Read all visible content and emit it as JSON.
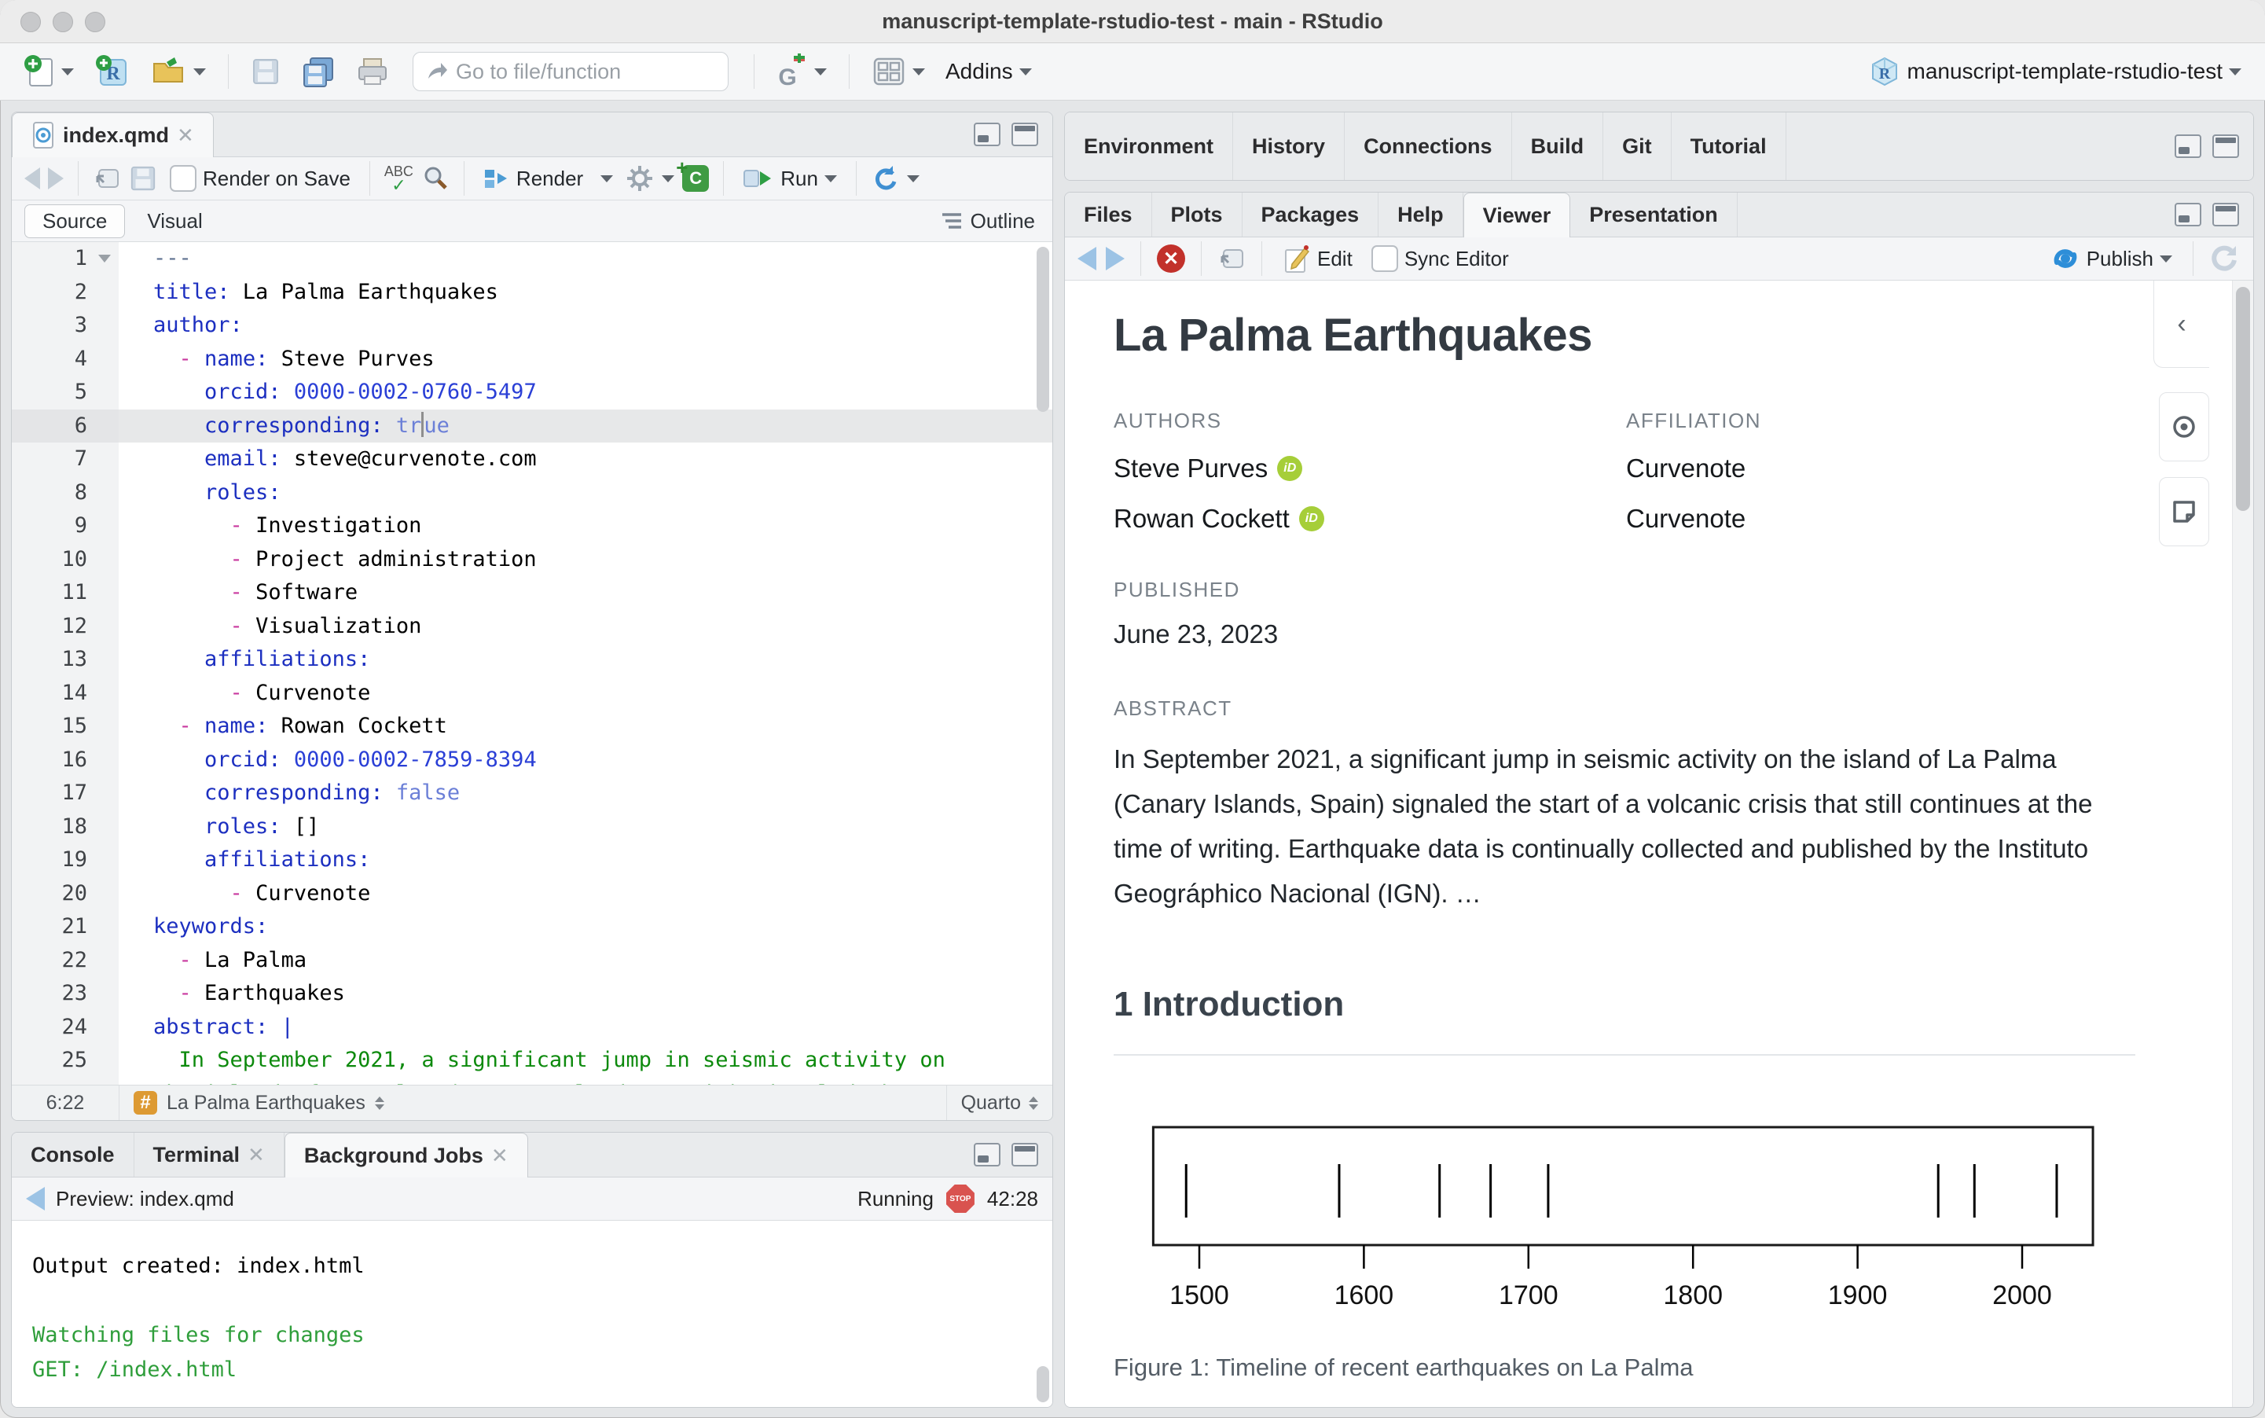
{
  "window": {
    "title": "manuscript-template-rstudio-test - main - RStudio"
  },
  "toolbar": {
    "goto_placeholder": "Go to file/function",
    "addins_label": "Addins",
    "project_label": "manuscript-template-rstudio-test"
  },
  "editor": {
    "tab": "index.qmd",
    "render_on_save": "Render on Save",
    "render_label": "Render",
    "run_label": "Run",
    "source_label": "Source",
    "visual_label": "Visual",
    "outline_label": "Outline",
    "status": {
      "position": "6:22",
      "section": "La Palma Earthquakes",
      "mode": "Quarto"
    },
    "lines": [
      {
        "n": "1",
        "fold": true,
        "segs": [
          [
            "m",
            "---"
          ]
        ]
      },
      {
        "n": "2",
        "segs": [
          [
            "k",
            "title:"
          ],
          [
            "p",
            " La Palma Earthquakes"
          ]
        ]
      },
      {
        "n": "3",
        "segs": [
          [
            "k",
            "author:"
          ]
        ]
      },
      {
        "n": "4",
        "segs": [
          [
            "p",
            "  "
          ],
          [
            "d",
            "-"
          ],
          [
            "p",
            " "
          ],
          [
            "k",
            "name:"
          ],
          [
            "p",
            " Steve Purves"
          ]
        ]
      },
      {
        "n": "5",
        "segs": [
          [
            "p",
            "    "
          ],
          [
            "k",
            "orcid:"
          ],
          [
            "p",
            " "
          ],
          [
            "n",
            "0000-0002-0760-5497"
          ]
        ]
      },
      {
        "n": "6",
        "current": true,
        "segs": [
          [
            "p",
            "    "
          ],
          [
            "k",
            "corresponding:"
          ],
          [
            "p",
            " "
          ],
          [
            "b",
            "tr"
          ],
          [
            "caret",
            ""
          ],
          [
            "b",
            "ue"
          ]
        ]
      },
      {
        "n": "7",
        "segs": [
          [
            "p",
            "    "
          ],
          [
            "k",
            "email:"
          ],
          [
            "p",
            " steve@curvenote.com"
          ]
        ]
      },
      {
        "n": "8",
        "segs": [
          [
            "p",
            "    "
          ],
          [
            "k",
            "roles:"
          ]
        ]
      },
      {
        "n": "9",
        "segs": [
          [
            "p",
            "      "
          ],
          [
            "d",
            "-"
          ],
          [
            "p",
            " Investigation"
          ]
        ]
      },
      {
        "n": "10",
        "segs": [
          [
            "p",
            "      "
          ],
          [
            "d",
            "-"
          ],
          [
            "p",
            " Project administration"
          ]
        ]
      },
      {
        "n": "11",
        "segs": [
          [
            "p",
            "      "
          ],
          [
            "d",
            "-"
          ],
          [
            "p",
            " Software"
          ]
        ]
      },
      {
        "n": "12",
        "segs": [
          [
            "p",
            "      "
          ],
          [
            "d",
            "-"
          ],
          [
            "p",
            " Visualization"
          ]
        ]
      },
      {
        "n": "13",
        "segs": [
          [
            "p",
            "    "
          ],
          [
            "k",
            "affiliations:"
          ]
        ]
      },
      {
        "n": "14",
        "segs": [
          [
            "p",
            "      "
          ],
          [
            "d",
            "-"
          ],
          [
            "p",
            " Curvenote"
          ]
        ]
      },
      {
        "n": "15",
        "segs": [
          [
            "p",
            "  "
          ],
          [
            "d",
            "-"
          ],
          [
            "p",
            " "
          ],
          [
            "k",
            "name:"
          ],
          [
            "p",
            " Rowan Cockett"
          ]
        ]
      },
      {
        "n": "16",
        "segs": [
          [
            "p",
            "    "
          ],
          [
            "k",
            "orcid:"
          ],
          [
            "p",
            " "
          ],
          [
            "n",
            "0000-0002-7859-8394"
          ]
        ]
      },
      {
        "n": "17",
        "segs": [
          [
            "p",
            "    "
          ],
          [
            "k",
            "corresponding:"
          ],
          [
            "p",
            " "
          ],
          [
            "b",
            "false"
          ]
        ]
      },
      {
        "n": "18",
        "segs": [
          [
            "p",
            "    "
          ],
          [
            "k",
            "roles:"
          ],
          [
            "p",
            " []"
          ]
        ]
      },
      {
        "n": "19",
        "segs": [
          [
            "p",
            "    "
          ],
          [
            "k",
            "affiliations:"
          ]
        ]
      },
      {
        "n": "20",
        "segs": [
          [
            "p",
            "      "
          ],
          [
            "d",
            "-"
          ],
          [
            "p",
            " Curvenote"
          ]
        ]
      },
      {
        "n": "21",
        "segs": [
          [
            "k",
            "keywords:"
          ]
        ]
      },
      {
        "n": "22",
        "segs": [
          [
            "p",
            "  "
          ],
          [
            "d",
            "-"
          ],
          [
            "p",
            " La Palma"
          ]
        ]
      },
      {
        "n": "23",
        "segs": [
          [
            "p",
            "  "
          ],
          [
            "d",
            "-"
          ],
          [
            "p",
            " Earthquakes"
          ]
        ]
      },
      {
        "n": "24",
        "segs": [
          [
            "k",
            "abstract:"
          ],
          [
            "p",
            " "
          ],
          [
            "k",
            "|"
          ]
        ]
      },
      {
        "n": "25",
        "segs": [
          [
            "s",
            "  In September 2021, a significant jump in seismic activity on"
          ]
        ]
      },
      {
        "n": "",
        "segs": [
          [
            "s",
            "the island of La Palma (Canary Islands, Spain) signaled the start"
          ]
        ]
      }
    ]
  },
  "console": {
    "tabs": [
      "Console",
      "Terminal",
      "Background Jobs"
    ],
    "active_tab": "Background Jobs",
    "toolbar": {
      "label": "Preview: index.qmd",
      "status": "Running",
      "stop": "STOP",
      "time": "42:28"
    },
    "output": [
      {
        "text": "Output created: index.html",
        "color": "black"
      },
      {
        "text": "",
        "color": "black"
      },
      {
        "text": "Watching files for changes",
        "color": "green"
      },
      {
        "text": "GET: /index.html",
        "color": "green"
      }
    ]
  },
  "right_top": {
    "tabs": [
      "Environment",
      "History",
      "Connections",
      "Build",
      "Git",
      "Tutorial"
    ]
  },
  "viewer": {
    "tabs": [
      "Files",
      "Plots",
      "Packages",
      "Help",
      "Viewer",
      "Presentation"
    ],
    "active_tab": "Viewer",
    "toolbar": {
      "edit": "Edit",
      "sync": "Sync Editor",
      "publish": "Publish"
    },
    "doc": {
      "title": "La Palma Earthquakes",
      "authors_label": "AUTHORS",
      "affiliation_label": "AFFILIATION",
      "authors": [
        {
          "name": "Steve Purves",
          "affiliation": "Curvenote"
        },
        {
          "name": "Rowan Cockett",
          "affiliation": "Curvenote"
        }
      ],
      "published_label": "PUBLISHED",
      "published": "June 23, 2023",
      "abstract_label": "ABSTRACT",
      "abstract": "In September 2021, a significant jump in seismic activity on the island of La Palma (Canary Islands, Spain) signaled the start of a volcanic crisis that still continues at the time of writing. Earthquake data is continually collected and published by the Instituto Geográphico Nacional (IGN). …",
      "section_heading": "1 Introduction",
      "figure_caption": "Figure 1: Timeline of recent earthquakes on La Palma"
    }
  },
  "chart_data": {
    "type": "scatter",
    "subtype": "rug-timeline",
    "title": "Timeline of recent earthquakes on La Palma",
    "x_values": [
      1492,
      1585,
      1646,
      1677,
      1712,
      1949,
      1971,
      2021
    ],
    "xticks": [
      1500,
      1600,
      1700,
      1800,
      1900,
      2000
    ],
    "xlim": [
      1472,
      2043
    ],
    "xlabel": "",
    "ylabel": "",
    "grid": false,
    "marker": "vertical-tick"
  },
  "colors": {
    "accent_blue": "#3f8fd2",
    "orcid_green": "#a6ce39",
    "console_green": "#2f9e3b",
    "yaml_key_blue": "#1c2fc0",
    "yaml_dash_magenta": "#c9399f",
    "string_green": "#0d8a0d",
    "stop_red": "#d9534f",
    "hash_orange": "#dd9a33"
  }
}
